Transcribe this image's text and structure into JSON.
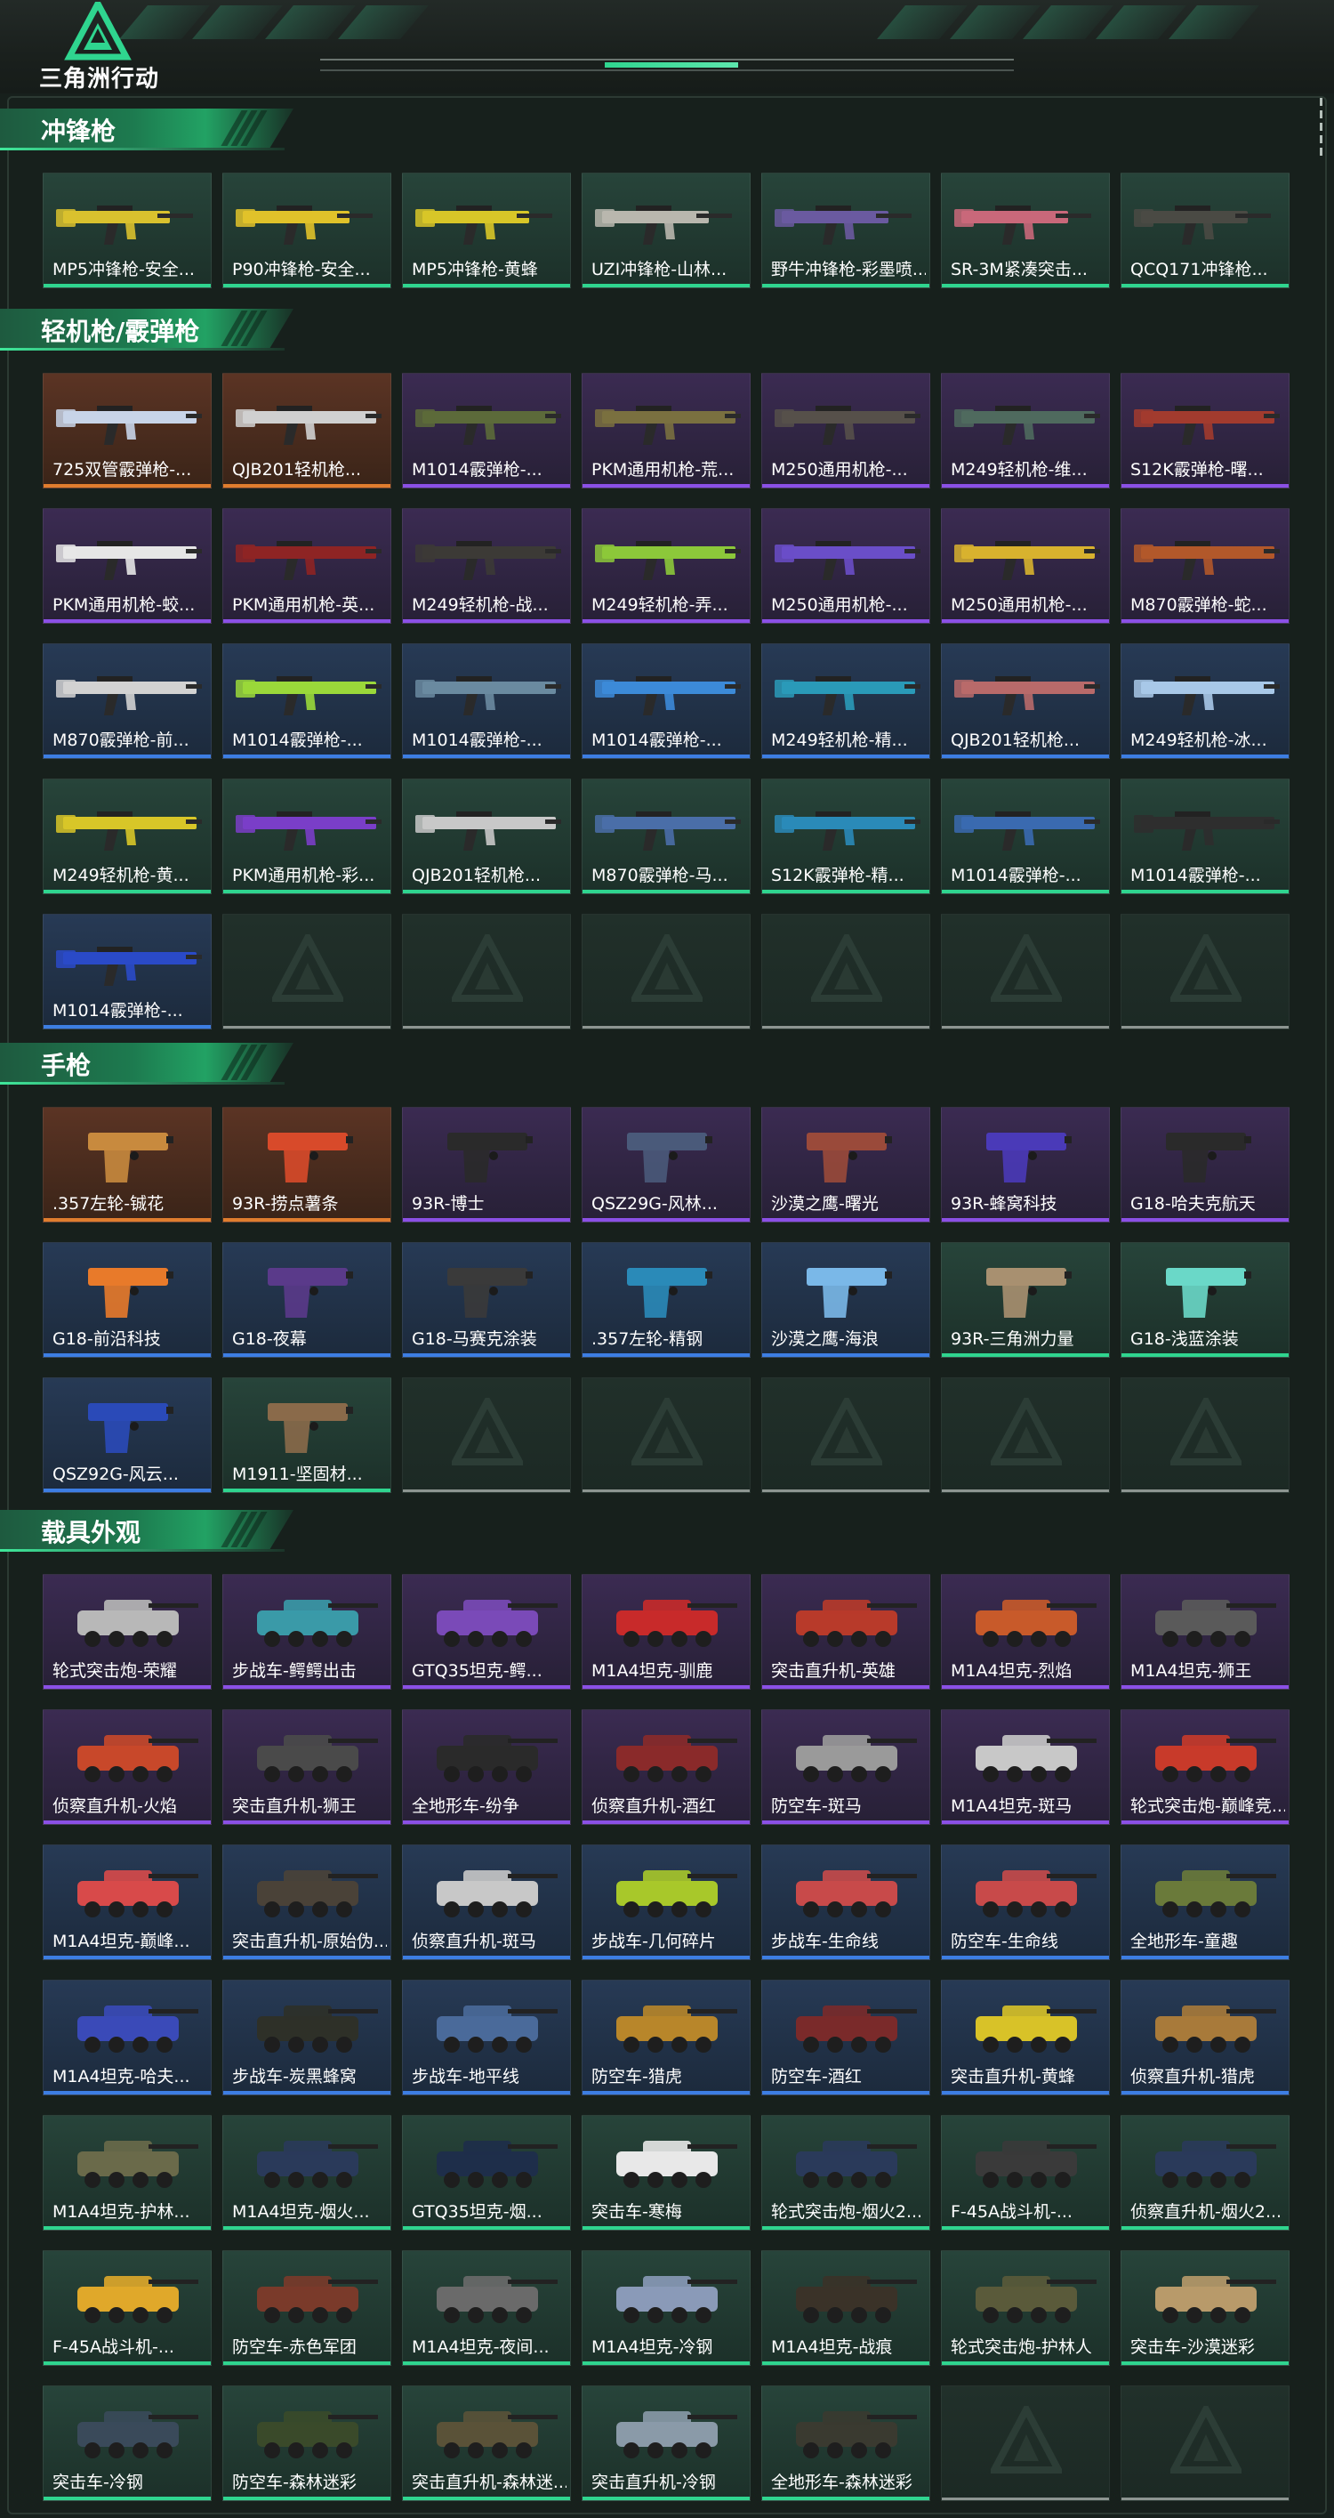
{
  "header": {
    "logo_text": "三角洲行动"
  },
  "colors": {
    "accent": "#2fd58f",
    "gold": "#e07d2e",
    "purple": "#8b50e6",
    "blue": "#3d7ee3",
    "green": "#2fd58f",
    "empty": "#8d9591"
  },
  "sections": [
    {
      "title": "冲锋枪",
      "kind": "smg",
      "items": [
        {
          "name": "MP5冲锋枪-安全...",
          "rarity": "green",
          "color": "#d9c12e"
        },
        {
          "name": "P90冲锋枪-安全...",
          "rarity": "green",
          "color": "#e0c22a"
        },
        {
          "name": "MP5冲锋枪-黄蜂",
          "rarity": "green",
          "color": "#d8c628"
        },
        {
          "name": "UZI冲锋枪-山林...",
          "rarity": "green",
          "color": "#b9b7ae"
        },
        {
          "name": "野牛冲锋枪-彩墨喷...",
          "rarity": "green",
          "color": "#6a5aa0"
        },
        {
          "name": "SR-3M紧凑突击...",
          "rarity": "green",
          "color": "#c9687a"
        },
        {
          "name": "QCQ171冲锋枪...",
          "rarity": "green",
          "color": "#4a4a44"
        }
      ]
    },
    {
      "title": "轻机枪/霰弹枪",
      "kind": "rifle",
      "items": [
        {
          "name": "725双管霰弹枪-...",
          "rarity": "gold",
          "color": "#c8d4e8"
        },
        {
          "name": "QJB201轻机枪...",
          "rarity": "gold",
          "color": "#d0d0d0"
        },
        {
          "name": "M1014霰弹枪-...",
          "rarity": "purple",
          "color": "#5c6a3a"
        },
        {
          "name": "PKM通用机枪-荒...",
          "rarity": "purple",
          "color": "#7a7040"
        },
        {
          "name": "M250通用机枪-...",
          "rarity": "purple",
          "color": "#56504a"
        },
        {
          "name": "M249轻机枪-维...",
          "rarity": "purple",
          "color": "#4f6a5e"
        },
        {
          "name": "S12K霰弹枪-曙...",
          "rarity": "purple",
          "color": "#a23b2e"
        },
        {
          "name": "PKM通用机枪-蛟...",
          "rarity": "purple",
          "color": "#e6e6e6"
        },
        {
          "name": "PKM通用机枪-英...",
          "rarity": "purple",
          "color": "#8e2424"
        },
        {
          "name": "M249轻机枪-战...",
          "rarity": "purple",
          "color": "#3c3a36"
        },
        {
          "name": "M249轻机枪-弄...",
          "rarity": "purple",
          "color": "#8cc83a"
        },
        {
          "name": "M250通用机枪-...",
          "rarity": "purple",
          "color": "#6a4ec8"
        },
        {
          "name": "M250通用机枪-...",
          "rarity": "purple",
          "color": "#d8b22e"
        },
        {
          "name": "M870霰弹枪-蛇...",
          "rarity": "purple",
          "color": "#b2582a"
        },
        {
          "name": "M870霰弹枪-前...",
          "rarity": "blue",
          "color": "#d2d2d2"
        },
        {
          "name": "M1014霰弹枪-...",
          "rarity": "blue",
          "color": "#9ad83a"
        },
        {
          "name": "M1014霰弹枪-...",
          "rarity": "blue",
          "color": "#6a8aa0"
        },
        {
          "name": "M1014霰弹枪-...",
          "rarity": "blue",
          "color": "#3c8ad8"
        },
        {
          "name": "M249轻机枪-精...",
          "rarity": "blue",
          "color": "#2a9ab8"
        },
        {
          "name": "QJB201轻机枪...",
          "rarity": "blue",
          "color": "#b86a6a"
        },
        {
          "name": "M249轻机枪-冰...",
          "rarity": "blue",
          "color": "#a8c8e8"
        },
        {
          "name": "M249轻机枪-黄...",
          "rarity": "green",
          "color": "#d8c628"
        },
        {
          "name": "PKM通用机枪-彩...",
          "rarity": "green",
          "color": "#7a3ec8"
        },
        {
          "name": "QJB201轻机枪...",
          "rarity": "green",
          "color": "#c8c8c8"
        },
        {
          "name": "M870霰弹枪-马...",
          "rarity": "green",
          "color": "#4a6ea8"
        },
        {
          "name": "S12K霰弹枪-精...",
          "rarity": "green",
          "color": "#2a8ab8"
        },
        {
          "name": "M1014霰弹枪-...",
          "rarity": "green",
          "color": "#3a6ab0"
        },
        {
          "name": "M1014霰弹枪-...",
          "rarity": "green",
          "color": "#2e2e2e"
        },
        {
          "name": "M1014霰弹枪-...",
          "rarity": "blue",
          "color": "#2a4ac8"
        },
        {
          "empty": true
        },
        {
          "empty": true
        },
        {
          "empty": true
        },
        {
          "empty": true
        },
        {
          "empty": true
        },
        {
          "empty": true
        }
      ]
    },
    {
      "title": "手枪",
      "kind": "pistol",
      "items": [
        {
          "name": ".357左轮-铖花",
          "rarity": "gold",
          "color": "#c88a3e"
        },
        {
          "name": "93R-捞点薯条",
          "rarity": "gold",
          "color": "#d84a2a"
        },
        {
          "name": "93R-博士",
          "rarity": "purple",
          "color": "#2a2a2a"
        },
        {
          "name": "QSZ29G-风林...",
          "rarity": "purple",
          "color": "#4a5a7a"
        },
        {
          "name": "沙漠之鹰-曙光",
          "rarity": "purple",
          "color": "#9a4a3a"
        },
        {
          "name": "93R-蜂窝科技",
          "rarity": "purple",
          "color": "#4a3ab8"
        },
        {
          "name": "G18-哈夫克航天",
          "rarity": "purple",
          "color": "#2a2a2a"
        },
        {
          "name": "G18-前沿科技",
          "rarity": "blue",
          "color": "#e87a2a"
        },
        {
          "name": "G18-夜幕",
          "rarity": "blue",
          "color": "#5a3a8a"
        },
        {
          "name": "G18-马赛克涂装",
          "rarity": "blue",
          "color": "#3a3a3a"
        },
        {
          "name": ".357左轮-精钢",
          "rarity": "blue",
          "color": "#2a8ab8"
        },
        {
          "name": "沙漠之鹰-海浪",
          "rarity": "blue",
          "color": "#7ab8e8"
        },
        {
          "name": "93R-三角洲力量",
          "rarity": "green",
          "color": "#a89070"
        },
        {
          "name": "G18-浅蓝涂装",
          "rarity": "green",
          "color": "#6ad8c8"
        },
        {
          "name": "QSZ92G-风云...",
          "rarity": "blue",
          "color": "#2a4ab8"
        },
        {
          "name": "M1911-坚固材...",
          "rarity": "green",
          "color": "#8a6a4a"
        },
        {
          "empty": true
        },
        {
          "empty": true
        },
        {
          "empty": true
        },
        {
          "empty": true
        },
        {
          "empty": true
        }
      ]
    },
    {
      "title": "载具外观",
      "kind": "vehicle",
      "items": [
        {
          "name": "轮式突击炮-荣耀",
          "rarity": "purple",
          "color": "#b8b8b8"
        },
        {
          "name": "步战车-鳄鳄出击",
          "rarity": "purple",
          "color": "#3a9aa8"
        },
        {
          "name": "GTQ35坦克-鳄...",
          "rarity": "purple",
          "color": "#7a4ab8"
        },
        {
          "name": "M1A4坦克-驯鹿",
          "rarity": "purple",
          "color": "#c82a2a"
        },
        {
          "name": "突击直升机-英雄",
          "rarity": "purple",
          "color": "#b83a2a"
        },
        {
          "name": "M1A4坦克-烈焰",
          "rarity": "purple",
          "color": "#c85a2a"
        },
        {
          "name": "M1A4坦克-狮王",
          "rarity": "purple",
          "color": "#5a5a5a"
        },
        {
          "name": "侦察直升机-火焰",
          "rarity": "purple",
          "color": "#c8482a"
        },
        {
          "name": "突击直升机-狮王",
          "rarity": "purple",
          "color": "#4a4a4a"
        },
        {
          "name": "全地形车-纷争",
          "rarity": "purple",
          "color": "#2a2a2a"
        },
        {
          "name": "侦察直升机-酒红",
          "rarity": "purple",
          "color": "#8a2a2a"
        },
        {
          "name": "防空车-斑马",
          "rarity": "purple",
          "color": "#9a9a9a"
        },
        {
          "name": "M1A4坦克-斑马",
          "rarity": "purple",
          "color": "#c8c8c8"
        },
        {
          "name": "轮式突击炮-巅峰竞...",
          "rarity": "purple",
          "color": "#c83a2a"
        },
        {
          "name": "M1A4坦克-巅峰...",
          "rarity": "blue",
          "color": "#d84a4a"
        },
        {
          "name": "突击直升机-原始伪...",
          "rarity": "blue",
          "color": "#4a4238"
        },
        {
          "name": "侦察直升机-斑马",
          "rarity": "blue",
          "color": "#c8c8c8"
        },
        {
          "name": "步战车-几何碎片",
          "rarity": "blue",
          "color": "#a8c82a"
        },
        {
          "name": "步战车-生命线",
          "rarity": "blue",
          "color": "#c84a4a"
        },
        {
          "name": "防空车-生命线",
          "rarity": "blue",
          "color": "#c84a4a"
        },
        {
          "name": "全地形车-童趣",
          "rarity": "blue",
          "color": "#6a7a3a"
        },
        {
          "name": "M1A4坦克-哈夫...",
          "rarity": "blue",
          "color": "#3a4ab8"
        },
        {
          "name": "步战车-炭黑蜂窝",
          "rarity": "blue",
          "color": "#2e3028"
        },
        {
          "name": "步战车-地平线",
          "rarity": "blue",
          "color": "#4a6a9a"
        },
        {
          "name": "防空车-猎虎",
          "rarity": "blue",
          "color": "#b8862a"
        },
        {
          "name": "防空车-酒红",
          "rarity": "blue",
          "color": "#7a2a2a"
        },
        {
          "name": "突击直升机-黄蜂",
          "rarity": "blue",
          "color": "#d8c228"
        },
        {
          "name": "侦察直升机-猎虎",
          "rarity": "blue",
          "color": "#a87a3a"
        },
        {
          "name": "M1A4坦克-护林...",
          "rarity": "green",
          "color": "#6a6a4a"
        },
        {
          "name": "M1A4坦克-烟火...",
          "rarity": "green",
          "color": "#2a3a5a"
        },
        {
          "name": "GTQ35坦克-烟...",
          "rarity": "green",
          "color": "#1e2e4a"
        },
        {
          "name": "突击车-寒梅",
          "rarity": "green",
          "color": "#e8e8e8"
        },
        {
          "name": "轮式突击炮-烟火2...",
          "rarity": "green",
          "color": "#2a3a5a"
        },
        {
          "name": "F-45A战斗机-...",
          "rarity": "green",
          "color": "#3a3a3a"
        },
        {
          "name": "侦察直升机-烟火2...",
          "rarity": "green",
          "color": "#2a3a5a"
        },
        {
          "name": "F-45A战斗机-...",
          "rarity": "green",
          "color": "#e0a82a"
        },
        {
          "name": "防空车-赤色军团",
          "rarity": "green",
          "color": "#7a3a2a"
        },
        {
          "name": "M1A4坦克-夜间...",
          "rarity": "green",
          "color": "#6a6a6a"
        },
        {
          "name": "M1A4坦克-冷钢",
          "rarity": "green",
          "color": "#8a9ab8"
        },
        {
          "name": "M1A4坦克-战痕",
          "rarity": "green",
          "color": "#3a3228"
        },
        {
          "name": "轮式突击炮-护林人",
          "rarity": "green",
          "color": "#5a5a3a"
        },
        {
          "name": "突击车-沙漠迷彩",
          "rarity": "green",
          "color": "#b89a6a"
        },
        {
          "name": "突击车-冷钢",
          "rarity": "green",
          "color": "#3a4a5a"
        },
        {
          "name": "防空车-森林迷彩",
          "rarity": "green",
          "color": "#3a4a2a"
        },
        {
          "name": "突击直升机-森林迷...",
          "rarity": "green",
          "color": "#5a5238"
        },
        {
          "name": "突击直升机-冷钢",
          "rarity": "green",
          "color": "#8a9aa8"
        },
        {
          "name": "全地形车-森林迷彩",
          "rarity": "green",
          "color": "#3a3a30"
        },
        {
          "empty": true
        },
        {
          "empty": true
        }
      ]
    }
  ]
}
